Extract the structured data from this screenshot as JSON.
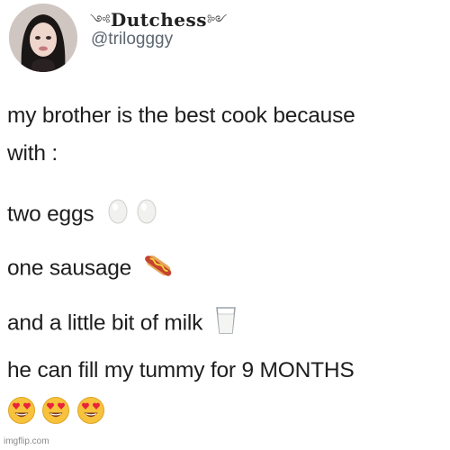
{
  "author": {
    "display_name": "Dutchess",
    "ornament_left": "༺",
    "ornament_right": "༻",
    "handle": "@trilogggy"
  },
  "tweet": {
    "line1": "my brother is the best cook because",
    "line2": "with :",
    "item1": "two eggs",
    "item2": "one sausage",
    "item3": "and a little bit of milk",
    "punchline": "he can fill my tummy for 9 MONTHS"
  },
  "icons": {
    "egg": "egg-icon",
    "hotdog": "hot-dog-icon",
    "milk": "glass-of-milk-icon",
    "heart_eyes": "heart-eyes-face-icon"
  },
  "watermark": "imgflip.com",
  "colors": {
    "text": "#1e1e1e",
    "handle": "#5c6670",
    "emoji_face": "#f7c23c",
    "emoji_heart": "#e8233b"
  }
}
